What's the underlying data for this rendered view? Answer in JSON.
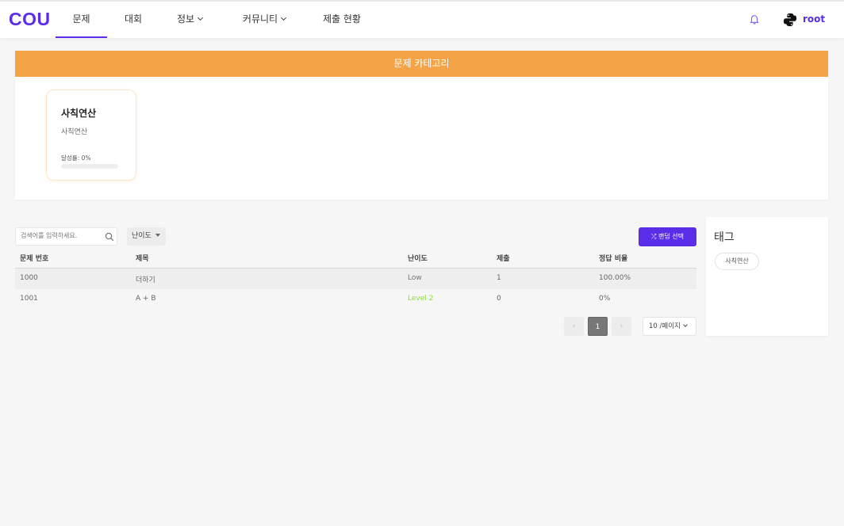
{
  "header": {
    "logo": "COU",
    "nav": [
      {
        "label": "문제",
        "active": true
      },
      {
        "label": "대회"
      },
      {
        "label": "정보"
      },
      {
        "label": "커뮤니티"
      },
      {
        "label": "제출 현황"
      }
    ],
    "username": "root"
  },
  "category": {
    "header": "문제 카테고리",
    "card": {
      "title": "사칙연산",
      "subtitle": "사칙연산",
      "rate_label": "달성률: 0%",
      "rate_value": 0
    }
  },
  "search": {
    "placeholder": "검색어를 입력하세요."
  },
  "difficulty_filter": {
    "label": "난이도"
  },
  "random_button": {
    "label": "⤮ 랜덤 선택"
  },
  "table": {
    "columns": [
      "문제 번호",
      "제목",
      "난이도",
      "제출",
      "정답 비율"
    ],
    "rows": [
      {
        "id": "1000",
        "title": "더하기",
        "difficulty": "Low",
        "submissions": "1",
        "ratio": "100.00%"
      },
      {
        "id": "1001",
        "title": "A + B",
        "difficulty": "Level 2",
        "submissions": "0",
        "ratio": "0%"
      }
    ]
  },
  "pagination": {
    "prev": "‹",
    "current": "1",
    "next": "›",
    "page_size": "10 /페이지"
  },
  "tags": {
    "title": "태그",
    "items": [
      "사칙연산"
    ]
  },
  "colors": {
    "brand": "#5a2de8",
    "category_header": "#f5a445",
    "level2": "#8ddc4a"
  }
}
